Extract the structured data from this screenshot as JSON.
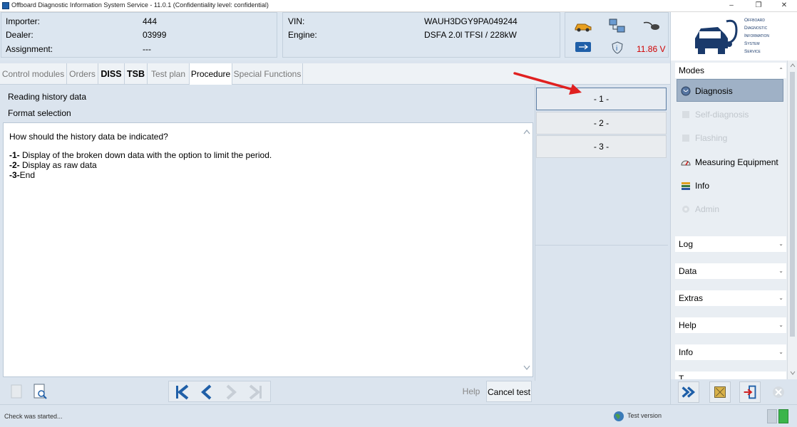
{
  "window": {
    "title": "Offboard Diagnostic Information System Service - 11.0.1 (Confidentiality level: confidential)",
    "controls": [
      "–",
      "❐",
      "✕"
    ]
  },
  "header": {
    "importer_label": "Importer:",
    "importer_value": "444",
    "dealer_label": "Dealer:",
    "dealer_value": "03999",
    "assignment_label": "Assignment:",
    "assignment_value": "---",
    "vin_label": "VIN:",
    "vin_value": "WAUH3DGY9PA049244",
    "engine_label": "Engine:",
    "engine_value": "DSFA 2.0l TFSI / 228kW",
    "voltage": "11.86 V",
    "voltage_color": "#d00000"
  },
  "logo": {
    "lines": [
      "Offboard",
      "Diagnostic",
      "Information",
      "System",
      "Service"
    ],
    "color": "#1a3a6b"
  },
  "tabs": [
    {
      "label": "Control modules"
    },
    {
      "label": "Orders"
    },
    {
      "label": "DISS"
    },
    {
      "label": "TSB"
    },
    {
      "label": "Test plan"
    },
    {
      "label": "Procedure"
    },
    {
      "label": "Special Functions"
    }
  ],
  "procedure": {
    "title": "Reading history data",
    "subtitle": "Format selection",
    "question": "How should the history data be indicated?",
    "options": [
      {
        "key": "-1-",
        "text": " Display of the broken down data with the option to limit the period."
      },
      {
        "key": "-2-",
        "text": " Display as raw data"
      },
      {
        "key": "-3-",
        "text": "End"
      }
    ]
  },
  "answers": [
    "- 1 -",
    "- 2 -",
    "- 3 -"
  ],
  "sidebar": {
    "modes_label": "Modes",
    "modes": [
      {
        "label": "Diagnosis",
        "icon": "stethoscope-icon"
      },
      {
        "label": "Self-diagnosis",
        "icon": "self-diagnosis-icon"
      },
      {
        "label": "Flashing",
        "icon": "flashing-icon"
      },
      {
        "label": "Measuring Equipment",
        "icon": "gauge-icon"
      },
      {
        "label": "Info",
        "icon": "books-icon"
      },
      {
        "label": "Admin",
        "icon": "gear-icon"
      }
    ],
    "sections": [
      "Log",
      "Data",
      "Extras",
      "Help",
      "Info",
      "T"
    ]
  },
  "bottom": {
    "help_label": "Help",
    "cancel_label": "Cancel test"
  },
  "status": {
    "message": "Check was started...",
    "version_label": "Test version"
  },
  "colors": {
    "accent_blue": "#1f5fa8",
    "arrow_red": "#e02020"
  }
}
